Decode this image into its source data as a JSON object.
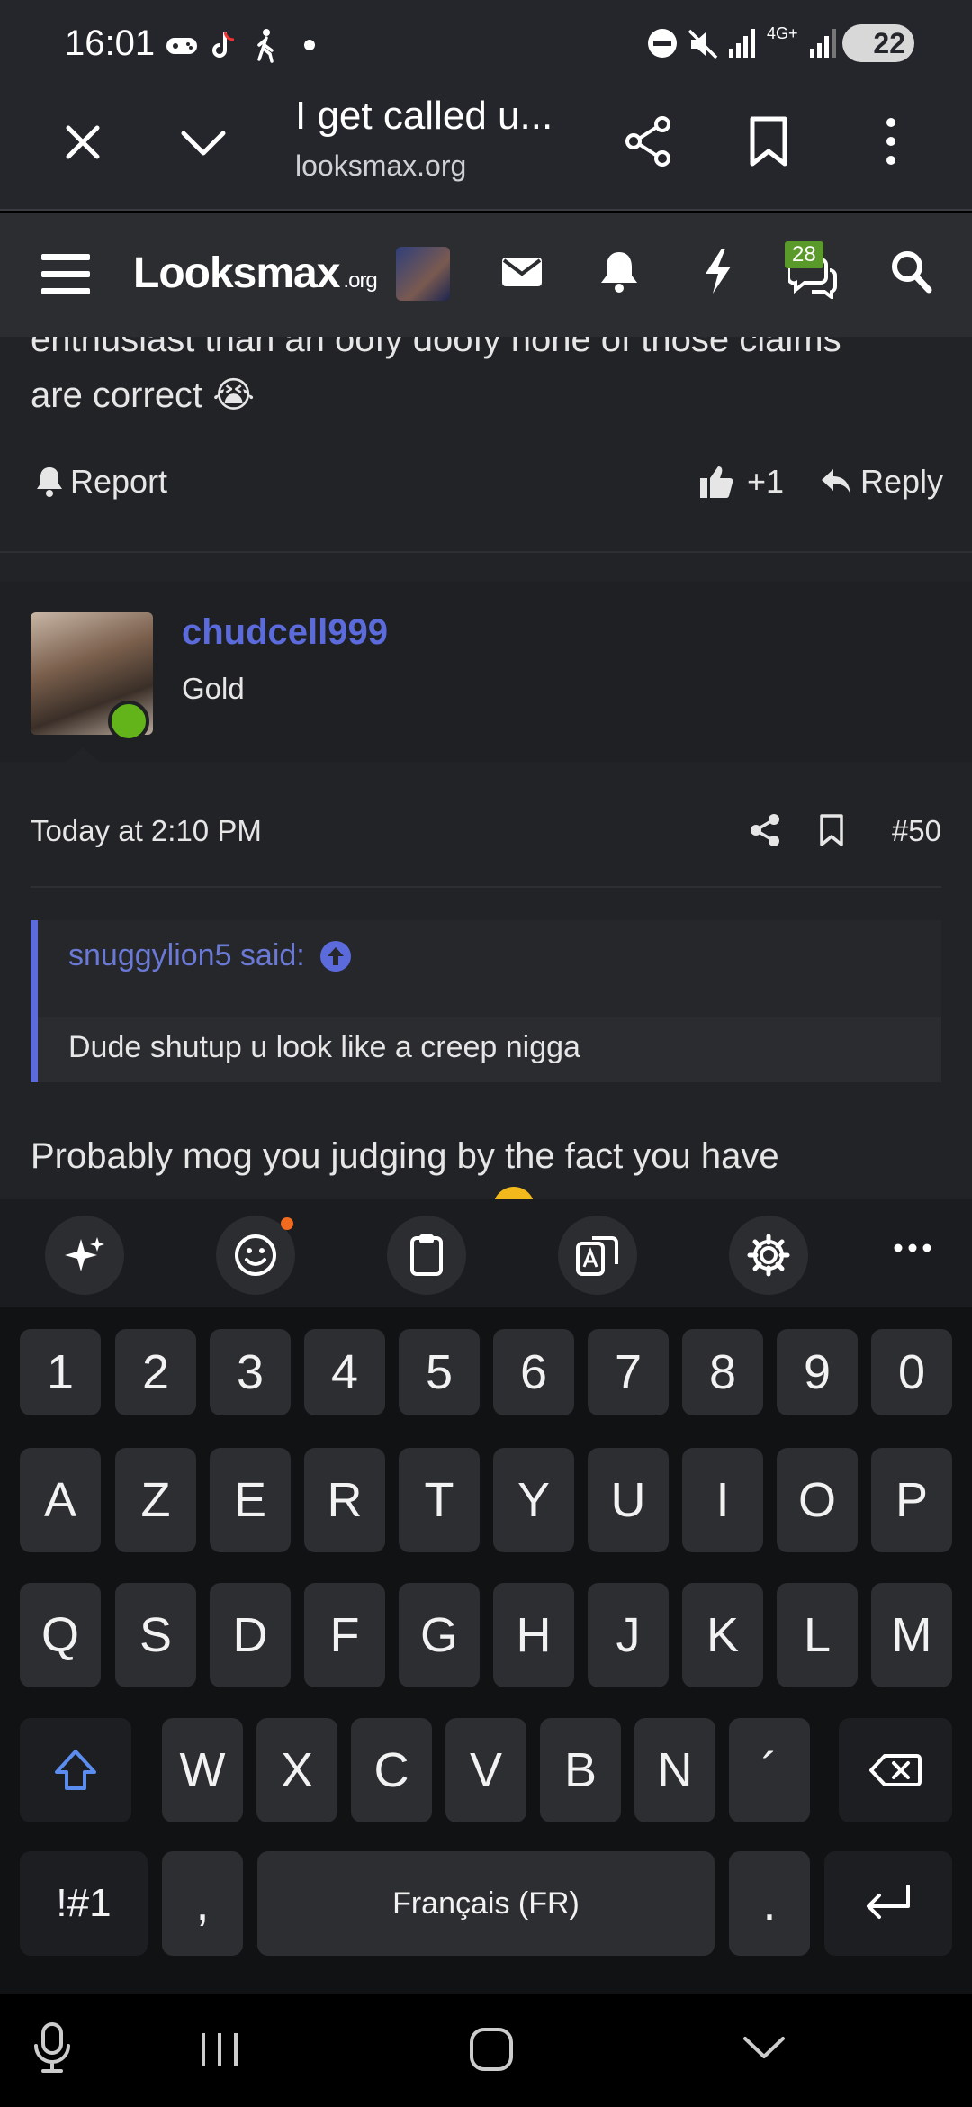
{
  "status_bar": {
    "time": "16:01",
    "network": "4G+",
    "battery": "22"
  },
  "browser": {
    "title": "I get called u...",
    "url": "looksmax.org"
  },
  "site_nav": {
    "logo": "Looksmax",
    "logo_suffix": ".org",
    "conversations_badge": "28"
  },
  "previous_post": {
    "tail_line1": "enthusiast than an oofy doofy none of those claims",
    "tail_line2": "are correct 😭",
    "report_label": "Report",
    "reaction_count": "+1",
    "reply_label": "Reply"
  },
  "post": {
    "username": "chudcell999",
    "user_title": "Gold",
    "date": "Today at 2:10 PM",
    "number": "#50",
    "quote_author": "snuggylion5 said:",
    "quote_text": "Dude shutup u look like a creep nigga",
    "body": "Probably mog you judging by the fact you have"
  },
  "keyboard": {
    "row_numbers": [
      "1",
      "2",
      "3",
      "4",
      "5",
      "6",
      "7",
      "8",
      "9",
      "0"
    ],
    "row1": [
      "A",
      "Z",
      "E",
      "R",
      "T",
      "Y",
      "U",
      "I",
      "O",
      "P"
    ],
    "row2": [
      "Q",
      "S",
      "D",
      "F",
      "G",
      "H",
      "J",
      "K",
      "L",
      "M"
    ],
    "row3": [
      "W",
      "X",
      "C",
      "V",
      "B",
      "N",
      "´"
    ],
    "symbols_label": "!#1",
    "comma": ",",
    "space_label": "Français (FR)",
    "period": "."
  },
  "colors": {
    "accent_link": "#5b6bdc",
    "online": "#63b31a",
    "badge": "#5a9a2a"
  }
}
